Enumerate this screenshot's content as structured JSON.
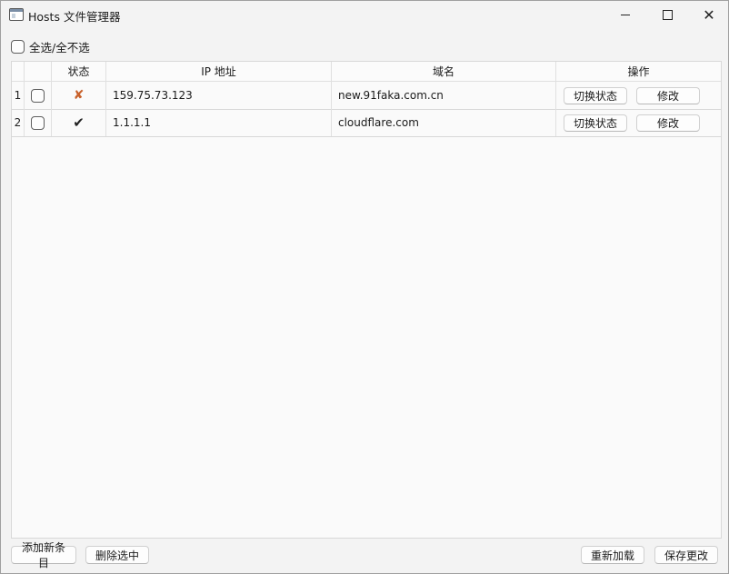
{
  "window": {
    "title": "Hosts 文件管理器"
  },
  "select_all_label": "全选/全不选",
  "table": {
    "headers": {
      "status": "状态",
      "ip": "IP 地址",
      "domain": "域名",
      "actions": "操作"
    },
    "rows": [
      {
        "num": "1",
        "status": "✘",
        "ip": "159.75.73.123",
        "domain": "new.91faka.com.cn",
        "toggle": "切换状态",
        "edit": "修改"
      },
      {
        "num": "2",
        "status": "✔",
        "ip": "1.1.1.1",
        "domain": "cloudflare.com",
        "toggle": "切换状态",
        "edit": "修改"
      }
    ]
  },
  "footer": {
    "add": "添加新条目",
    "delete": "删除选中",
    "reload": "重新加载",
    "save": "保存更改"
  }
}
